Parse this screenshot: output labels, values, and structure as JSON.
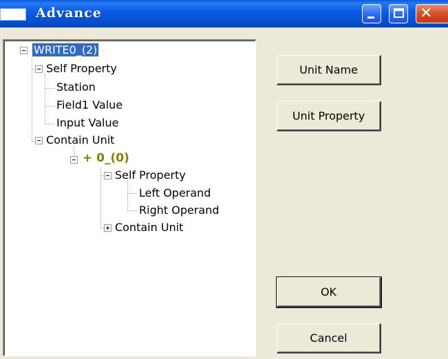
{
  "window": {
    "title": "Advance"
  },
  "tree": {
    "root": {
      "label": "WRITE0_(2)",
      "expanded": true,
      "selected": true
    },
    "self_property_1": {
      "label": "Self Property",
      "expanded": true
    },
    "station": {
      "label": "Station"
    },
    "field1_value": {
      "label": "Field1 Value"
    },
    "input_value": {
      "label": "Input Value"
    },
    "contain_unit_1": {
      "label": "Contain Unit",
      "expanded": true
    },
    "unit_plus": {
      "label": "+ 0_(0)",
      "expanded": true
    },
    "self_property_2": {
      "label": "Self Property",
      "expanded": true
    },
    "left_operand": {
      "label": "Left Operand"
    },
    "right_operand": {
      "label": "Right Operand"
    },
    "contain_unit_2": {
      "label": "Contain Unit",
      "expanded": false
    }
  },
  "buttons": {
    "unit_name": "Unit Name",
    "unit_property": "Unit Property",
    "ok": "OK",
    "cancel": "Cancel"
  },
  "icons": {
    "minimize": "minimize-icon",
    "maximize": "maximize-icon",
    "close": "close-icon",
    "expanded": "tree-collapse-icon",
    "collapsed": "tree-expand-icon"
  },
  "colors": {
    "titlebar": "#0553D8",
    "close_button": "#D24A24",
    "selection": "#316AC5",
    "unit_node_text": "#808000",
    "dialog_face": "#ECE9D8"
  }
}
